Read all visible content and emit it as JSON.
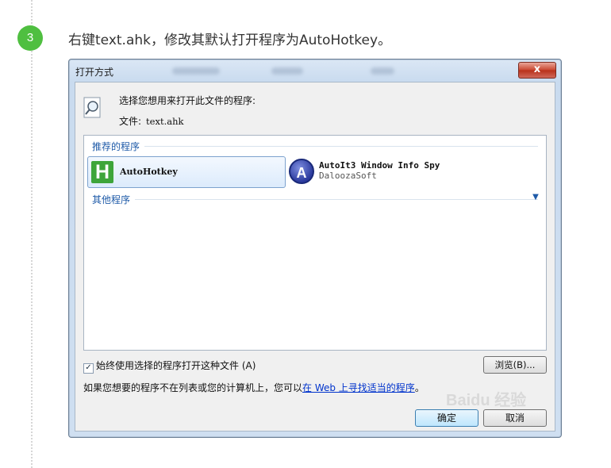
{
  "step": {
    "number": "3",
    "instruction": "右键text.ahk，修改其默认打开程序为AutoHotkey。"
  },
  "dialog": {
    "title": "打开方式",
    "close_label": "x",
    "prompt": "选择您想用来打开此文件的程序:",
    "file_label": "文件:",
    "file_name": "text.ahk",
    "recommended_header": "推荐的程序",
    "other_header": "其他程序",
    "programs": [
      {
        "name": "AutoHotkey",
        "icon": "ahk-h-icon",
        "selected": true
      },
      {
        "name": "AutoIt3 Window Info Spy",
        "publisher": "DaloozaSoft",
        "icon": "autoit-a-icon"
      }
    ],
    "always_use_label": "始终使用选择的程序打开这种文件 (A)",
    "always_use_checked": true,
    "browse_label": "浏览(B)...",
    "note_prefix": "如果您想要的程序不在列表或您的计算机上，您可以",
    "note_link": "在 Web 上寻找适当的程序",
    "note_suffix": "。",
    "ok_label": "确定",
    "cancel_label": "取消"
  },
  "watermark": "Baidu 经验",
  "colors": {
    "step_badge": "#4fbf40",
    "link": "#0033cc",
    "group_header": "#1e5aa8"
  }
}
